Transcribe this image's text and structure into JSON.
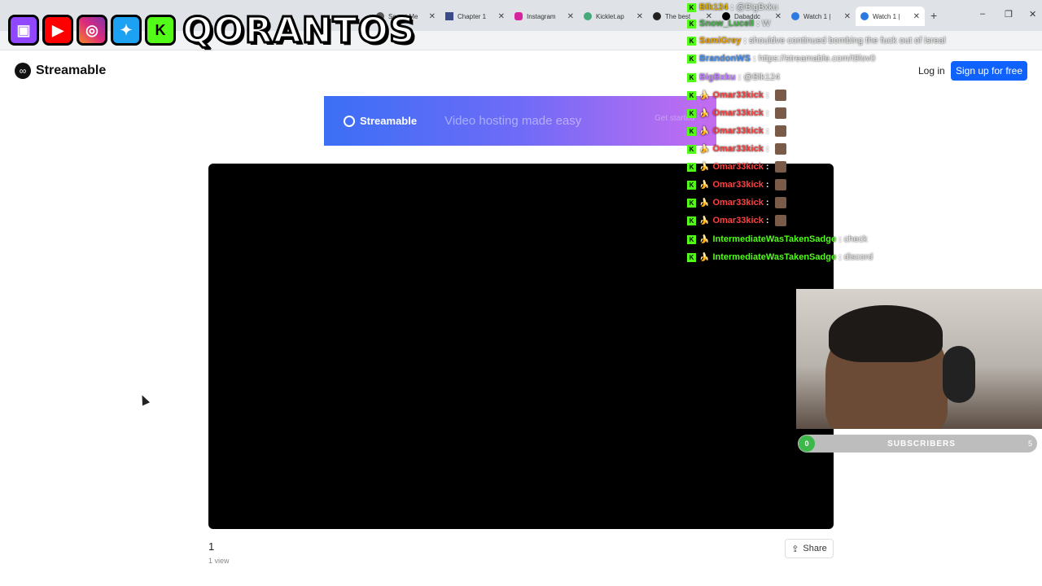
{
  "browser": {
    "tabs": [
      {
        "label": "Secret Me"
      },
      {
        "label": "Chapter 1"
      },
      {
        "label": "Instagram"
      },
      {
        "label": "Kicklet.ap"
      },
      {
        "label": "The best"
      },
      {
        "label": "Dabaddc"
      },
      {
        "label": "Watch 1 |"
      },
      {
        "label": "Watch 1 |"
      }
    ],
    "new_tab": "+",
    "window_controls": [
      "–",
      "❐",
      "✕"
    ]
  },
  "overlay": {
    "channel_name": "QORANTOS",
    "socials": [
      "twitch-icon",
      "youtube-icon",
      "instagram-icon",
      "twitter-icon",
      "kick-icon"
    ]
  },
  "streamable": {
    "brand": "Streamable",
    "login": "Log in",
    "signup": "Sign up for free",
    "banner": {
      "brand": "Streamable",
      "tagline": "Video hosting made easy",
      "cta": "Get started"
    },
    "views_count": "1",
    "views_label": "1 view",
    "share": "Share"
  },
  "chat": [
    {
      "user": "Blk124",
      "text": "@BigBxku",
      "color": "#e0b000"
    },
    {
      "user": "Snow_Lucell",
      "text": "W",
      "color": "#4caf50"
    },
    {
      "user": "SamiGrey",
      "text": "shouldve continued bombing the fuck out of isreal",
      "color": "#f0a000"
    },
    {
      "user": "BrandonWS",
      "text": "https://streamable.com/t9lov0",
      "color": "#4a8fe8"
    },
    {
      "user": "BigBxku",
      "text": "@Blk124",
      "color": "#c080ff"
    },
    {
      "user": "Omar33kick",
      "text": "",
      "color": "#ff4040"
    },
    {
      "user": "Omar33kick",
      "text": "",
      "color": "#ff4040"
    },
    {
      "user": "Omar33kick",
      "text": "",
      "color": "#ff4040"
    },
    {
      "user": "Omar33kick",
      "text": "",
      "color": "#ff4040"
    },
    {
      "user": "Omar33kick",
      "text": "",
      "color": "#ff4040"
    },
    {
      "user": "Omar33kick",
      "text": "",
      "color": "#ff4040"
    },
    {
      "user": "Omar33kick",
      "text": "",
      "color": "#ff4040"
    },
    {
      "user": "Omar33kick",
      "text": "",
      "color": "#ff4040"
    },
    {
      "user": "IntermediateWasTakenSadge",
      "text": "check",
      "color": "#53fc18"
    },
    {
      "user": "IntermediateWasTakenSadge",
      "text": "discord",
      "color": "#53fc18"
    }
  ],
  "subscribers": {
    "current": "0",
    "label": "SUBSCRIBERS",
    "goal": "5"
  },
  "colors": {
    "accent": "#0f62fe",
    "kick_green": "#53fc18"
  }
}
